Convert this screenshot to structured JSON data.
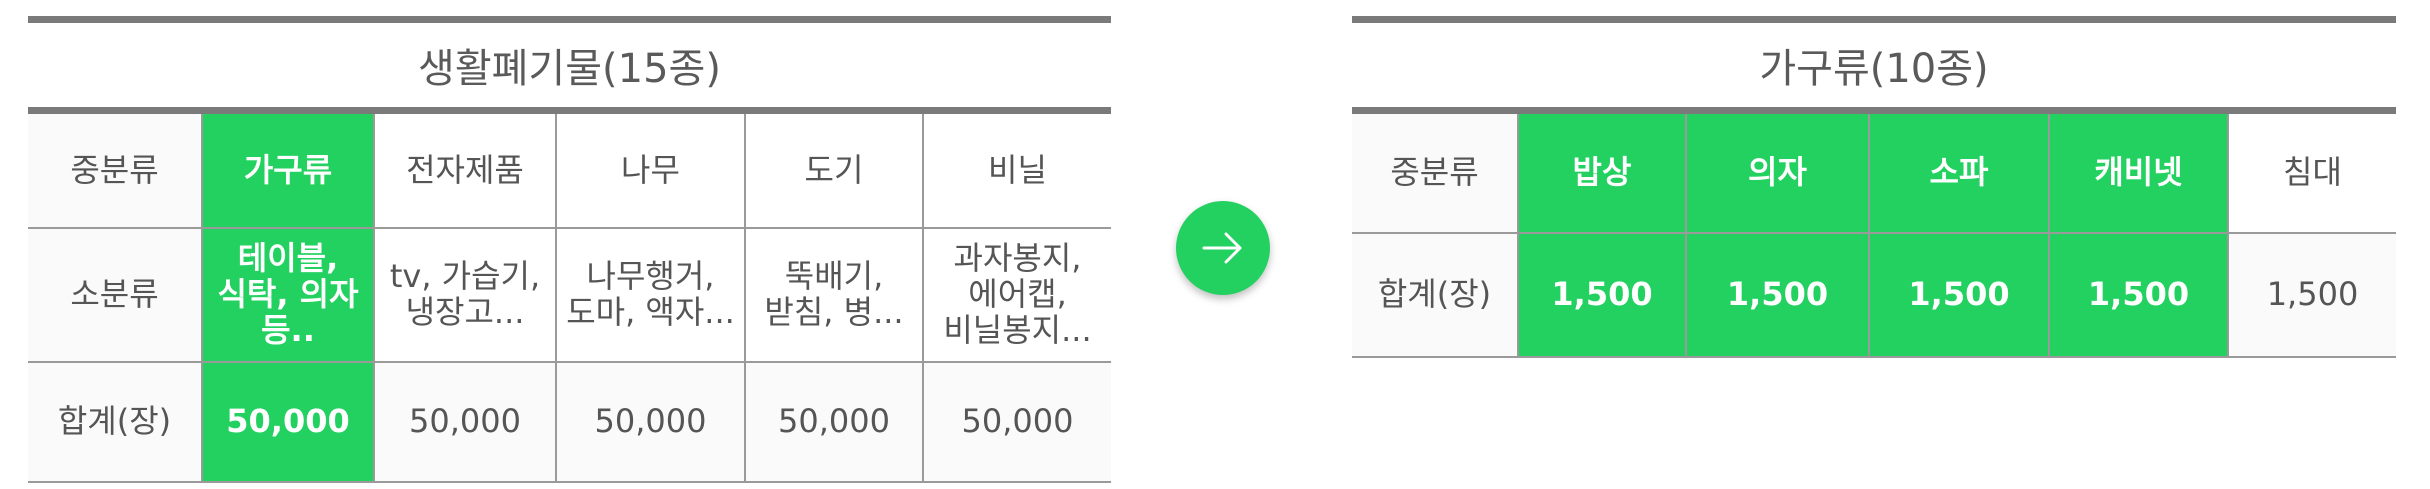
{
  "left": {
    "title": "생활폐기물(15종)",
    "row_labels": [
      "중분류",
      "소분류",
      "합계(장)"
    ],
    "columns": [
      {
        "category": "가구류",
        "items": "테이블, 식탁, 의자 등..",
        "total": "50,000",
        "highlighted": true
      },
      {
        "category": "전자제품",
        "items": "tv, 가습기, 냉장고...",
        "total": "50,000",
        "highlighted": false
      },
      {
        "category": "나무",
        "items": "나무행거, 도마, 액자...",
        "total": "50,000",
        "highlighted": false
      },
      {
        "category": "도기",
        "items": "뚝배기, 받침, 병...",
        "total": "50,000",
        "highlighted": false
      },
      {
        "category": "비닐",
        "items": "과자봉지, 에어캡, 비닐봉지...",
        "total": "50,000",
        "highlighted": false
      }
    ]
  },
  "right": {
    "title": "가구류(10종)",
    "row_labels": [
      "중분류",
      "합계(장)"
    ],
    "columns": [
      {
        "category": "밥상",
        "total": "1,500",
        "highlighted": true
      },
      {
        "category": "의자",
        "total": "1,500",
        "highlighted": true
      },
      {
        "category": "소파",
        "total": "1,500",
        "highlighted": true
      },
      {
        "category": "캐비넷",
        "total": "1,500",
        "highlighted": true
      },
      {
        "category": "침대",
        "total": "1,500",
        "highlighted": false
      }
    ]
  },
  "arrow": {
    "icon": "arrow-right-icon"
  },
  "colors": {
    "accent": "#22d160",
    "rule": "#7a7a7a",
    "border": "#9a9a9a",
    "text": "#555555"
  }
}
